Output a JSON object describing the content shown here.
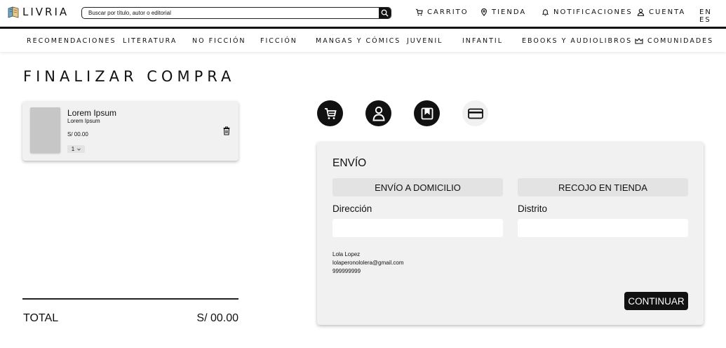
{
  "header": {
    "logo_text": "LIVRIA",
    "search_placeholder": "Buscar por título, autor o editorial",
    "nav": [
      {
        "label": "CARRITO",
        "icon": "cart-icon"
      },
      {
        "label": "TIENDA",
        "icon": "location-pin-icon"
      },
      {
        "label": "NOTIFICACIONES",
        "icon": "bell-icon"
      },
      {
        "label": "CUENTA",
        "icon": "user-icon"
      }
    ],
    "language": "EN ES"
  },
  "categories": [
    "RECOMENDACIONES",
    "LITERATURA",
    "NO FICCIÓN",
    "FICCIÓN",
    "MANGAS Y CÓMICS",
    "JUVENIL",
    "INFANTIL",
    "EBOOKS Y AUDIOLIBROS",
    "COMUNIDADES"
  ],
  "page": {
    "title": "FINALIZAR COMPRA"
  },
  "cart": {
    "item": {
      "title": "Lorem Ipsum",
      "subtitle": "Lorem Ipsum",
      "price": "S/ 00.00",
      "quantity": "1"
    },
    "total_label": "TOTAL",
    "total_value": "S/ 00.00"
  },
  "steps": [
    {
      "icon": "cart-icon",
      "state": "done"
    },
    {
      "icon": "user-icon",
      "state": "done"
    },
    {
      "icon": "bookmark-icon",
      "state": "done"
    },
    {
      "icon": "credit-card-icon",
      "state": "current"
    }
  ],
  "shipping": {
    "title": "ENVÍO",
    "option_home": "ENVÍO A DOMICILIO",
    "option_store": "RECOJO EN TIENDA",
    "address_label": "Dirección",
    "address_value": "",
    "district_label": "Distrito",
    "district_value": "",
    "contact_name": "Lola Lopez",
    "contact_email": "lolaperonololera@gmail.com",
    "contact_phone": "999999999",
    "continue_label": "CONTINUAR"
  },
  "colors": {
    "primary": "#111111",
    "panel_bg": "#f1f1f1",
    "button_bg": "#e3e3e3"
  }
}
